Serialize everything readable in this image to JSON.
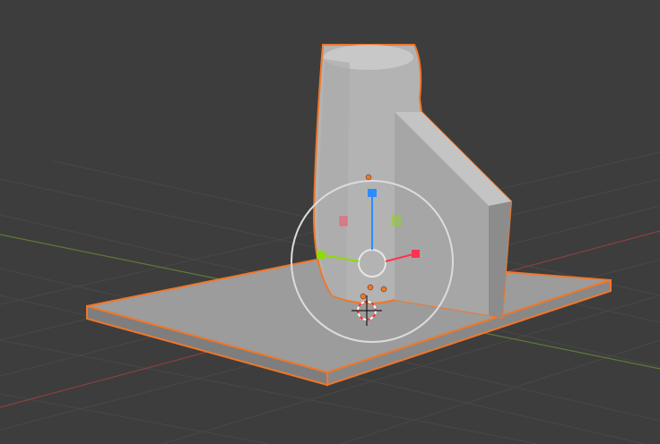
{
  "viewport": {
    "mode": "3d-viewport",
    "shading": "solid",
    "gizmo": "translate-rotate",
    "selection_outline_color": "#f0772a",
    "background_color": "#3d3d3d",
    "grid_color": "#4a4a4a",
    "axis_x_color": "#9c4545",
    "axis_y_color": "#6c8a3b",
    "gizmo_x_color": "#ff3352",
    "gizmo_y_color": "#8bdc00",
    "gizmo_z_color": "#2d8cff"
  },
  "objects": [
    {
      "name": "plate",
      "selected": true
    },
    {
      "name": "cylinder-bracket",
      "selected": true
    }
  ]
}
